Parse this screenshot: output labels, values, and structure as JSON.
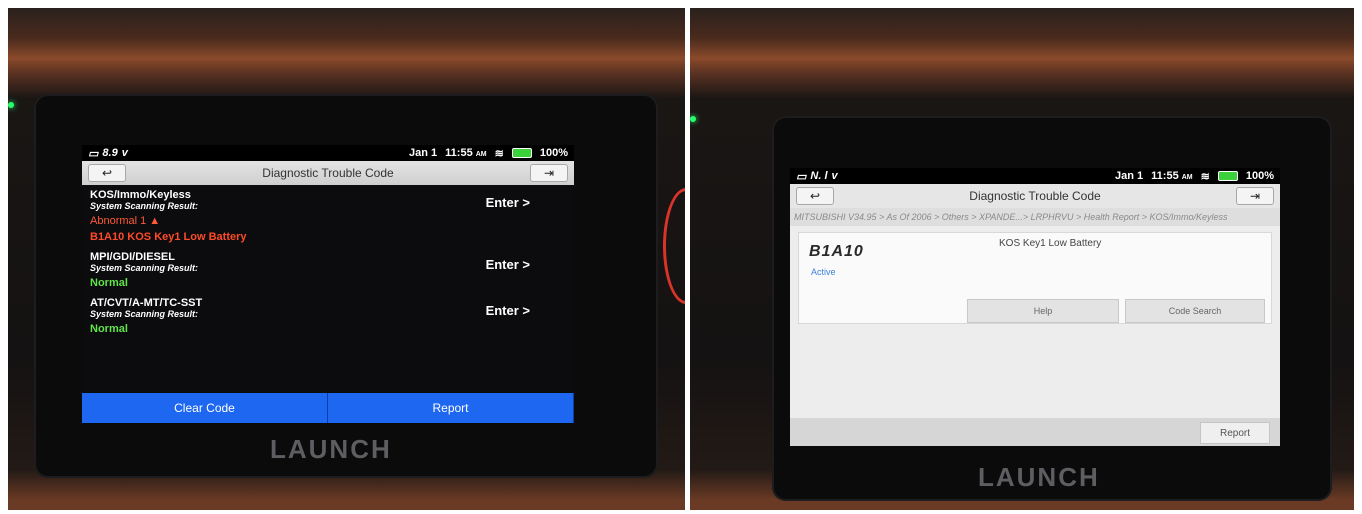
{
  "left": {
    "status": {
      "voltage": "8.9",
      "voltage_unit": "v",
      "date": "Jan 1",
      "time": "11:55",
      "ampm": "AM",
      "battery": "100%"
    },
    "title": "Diagnostic Trouble Code",
    "systems": [
      {
        "name": "KOS/Immo/Keyless",
        "sub": "System Scanning Result:",
        "state": "Abnormal 1 ▲",
        "code": "B1A10 KOS Key1 Low Battery",
        "enter": "Enter >"
      },
      {
        "name": "MPI/GDI/DIESEL",
        "sub": "System Scanning Result:",
        "state": "Normal",
        "enter": "Enter >"
      },
      {
        "name": "AT/CVT/A-MT/TC-SST",
        "sub": "System Scanning Result:",
        "state": "Normal",
        "enter": "Enter >"
      }
    ],
    "buttons": {
      "clear": "Clear Code",
      "report": "Report"
    },
    "logo": "LAUNCH"
  },
  "right": {
    "status": {
      "voltage": "N. l",
      "voltage_unit": "v",
      "date": "Jan 1",
      "time": "11:55",
      "ampm": "AM",
      "battery": "100%"
    },
    "title": "Diagnostic Trouble Code",
    "breadcrumb": "MITSUBISHI V34.95 > As Of 2006 > Others > XPANDE...> LRPHRVU > Health Report > KOS/Immo/Keyless",
    "dtc": {
      "code": "B1A10",
      "status": "Active",
      "description": "KOS Key1 Low Battery"
    },
    "buttons": {
      "help": "Help",
      "code_search": "Code Search",
      "report": "Report"
    },
    "logo": "LAUNCH"
  },
  "colors": {
    "accent_blue": "#1e67f0",
    "abnormal": "#ff5a36",
    "normal": "#61e34a",
    "active": "#3b84d8"
  }
}
